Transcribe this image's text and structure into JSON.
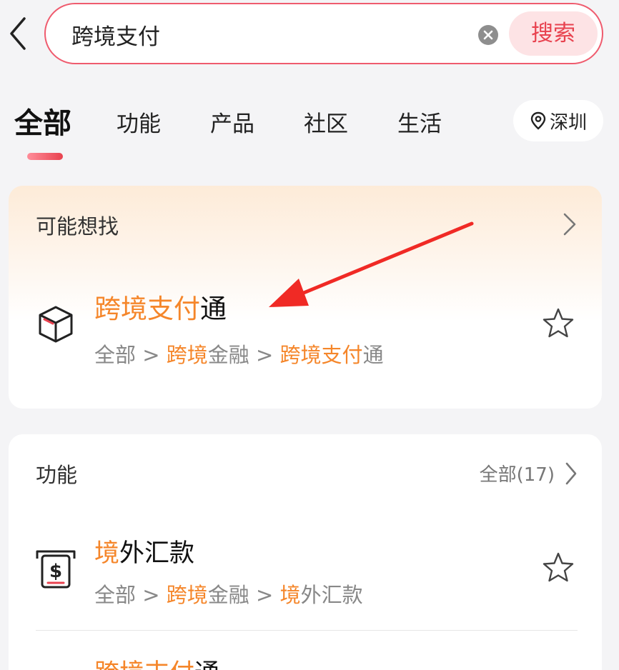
{
  "search": {
    "query": "跨境支付",
    "button_label": "搜索"
  },
  "tabs": [
    {
      "label": "全部",
      "active": true
    },
    {
      "label": "功能",
      "active": false
    },
    {
      "label": "产品",
      "active": false
    },
    {
      "label": "社区",
      "active": false
    },
    {
      "label": "生活",
      "active": false
    }
  ],
  "location": {
    "city": "深圳"
  },
  "suggestion_card": {
    "header": "可能想找",
    "item": {
      "title_highlight": "跨境支付",
      "title_rest": "通",
      "path": [
        {
          "text": "全部"
        },
        {
          "sep": " > "
        },
        {
          "hl": "跨境",
          "text": "金融"
        },
        {
          "sep": " > "
        },
        {
          "hl": "跨境支付",
          "text": "通"
        }
      ],
      "p0": "全部",
      "p_sep": " > ",
      "p1_hl": "跨境",
      "p1_rest": "金融",
      "p2_hl": "跨境支付",
      "p2_rest": "通"
    }
  },
  "functions_card": {
    "header": "功能",
    "more_label": "全部(17)",
    "items": [
      {
        "title_highlight": "境",
        "title_rest": "外汇款",
        "p0": "全部",
        "p_sep": " > ",
        "p1_hl": "跨境",
        "p1_rest": "金融",
        "p2_hl": "境",
        "p2_rest": "外汇款"
      },
      {
        "title_highlight": "跨境支付",
        "title_rest": "通"
      }
    ]
  },
  "colors": {
    "accent_red": "#e8424f",
    "highlight_orange": "#f5862a",
    "arrow_red": "#f02a25"
  }
}
